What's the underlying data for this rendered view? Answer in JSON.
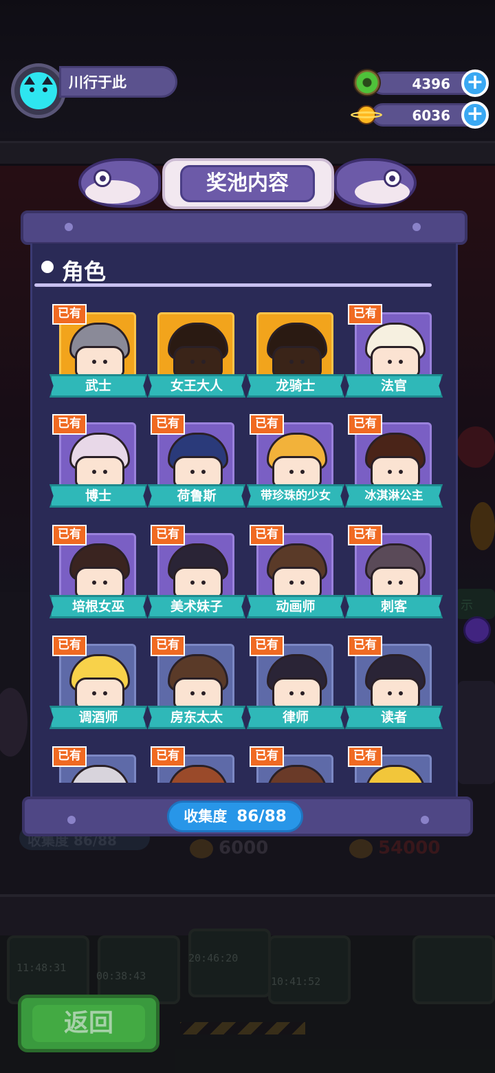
{
  "user": {
    "name": "川行于此"
  },
  "currency": {
    "donut": {
      "amount": "4396",
      "icon": "donut-icon"
    },
    "coin": {
      "amount": "6036",
      "icon": "planet-coin-icon"
    }
  },
  "dialog": {
    "title": "奖池内容",
    "section_title": "角色",
    "owned_label": "已有",
    "characters": [
      {
        "name": "武士",
        "owned": true
      },
      {
        "name": "女王大人",
        "owned": false
      },
      {
        "name": "龙骑士",
        "owned": false
      },
      {
        "name": "法官",
        "owned": true
      },
      {
        "name": "博士",
        "owned": true
      },
      {
        "name": "荷鲁斯",
        "owned": true
      },
      {
        "name": "带珍珠的少女",
        "owned": true
      },
      {
        "name": "冰淇淋公主",
        "owned": true
      },
      {
        "name": "培根女巫",
        "owned": true
      },
      {
        "name": "美术妹子",
        "owned": true
      },
      {
        "name": "动画师",
        "owned": true
      },
      {
        "name": "刺客",
        "owned": true
      },
      {
        "name": "调酒师",
        "owned": true
      },
      {
        "name": "房东太太",
        "owned": true
      },
      {
        "name": "律师",
        "owned": true
      },
      {
        "name": "读者",
        "owned": true
      },
      {
        "name": "",
        "owned": true
      },
      {
        "name": "",
        "owned": true
      },
      {
        "name": "",
        "owned": true
      },
      {
        "name": "",
        "owned": true
      }
    ],
    "collection_label": "收集度",
    "collection_value": "86/88"
  },
  "background": {
    "progress_text": "收集度 86/88",
    "price_coin": "6000",
    "price_red": "54000",
    "timers": [
      "11:48:31",
      "00:38:43",
      "20:46:20",
      "10:41:52"
    ]
  },
  "back_button": {
    "label": "返回"
  },
  "colors": {
    "panel": "#2a2a56",
    "owned_badge": "#f06a22",
    "ribbon": "#2fb8b8",
    "progress": "#2896e8"
  }
}
